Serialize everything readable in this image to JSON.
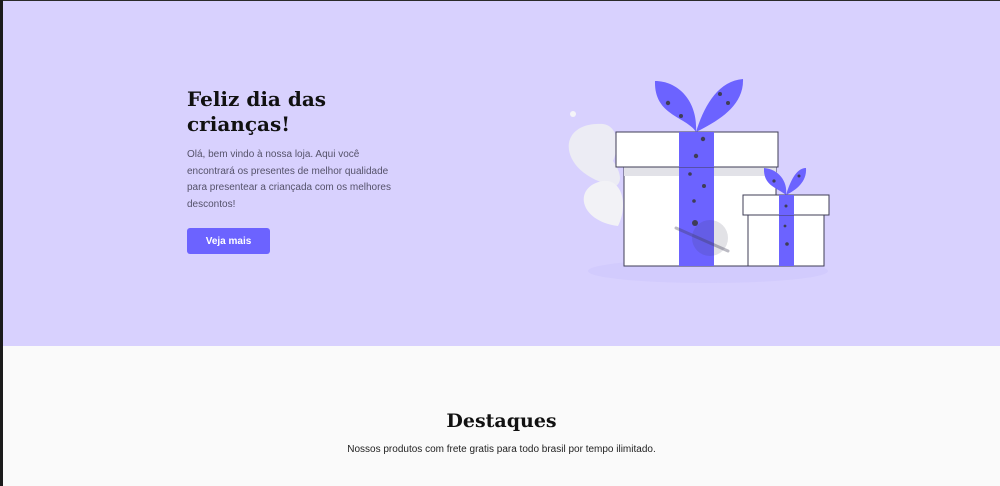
{
  "hero": {
    "title": "Feliz dia das crianças!",
    "description": "Olá, bem vindo à nossa loja. Aqui você encontrará os presentes de melhor qualidade para presentear a criançada com os melhores descontos!",
    "button_label": "Veja mais"
  },
  "featured": {
    "title": "Destaques",
    "subtitle": "Nossos produtos com frete gratis para todo brasil por tempo ilimitado."
  },
  "colors": {
    "hero_background": "#d8d1fe",
    "accent": "#6c63ff",
    "page_background": "#fafafa"
  },
  "icons": {
    "illustration": "gift-boxes-illustration"
  }
}
